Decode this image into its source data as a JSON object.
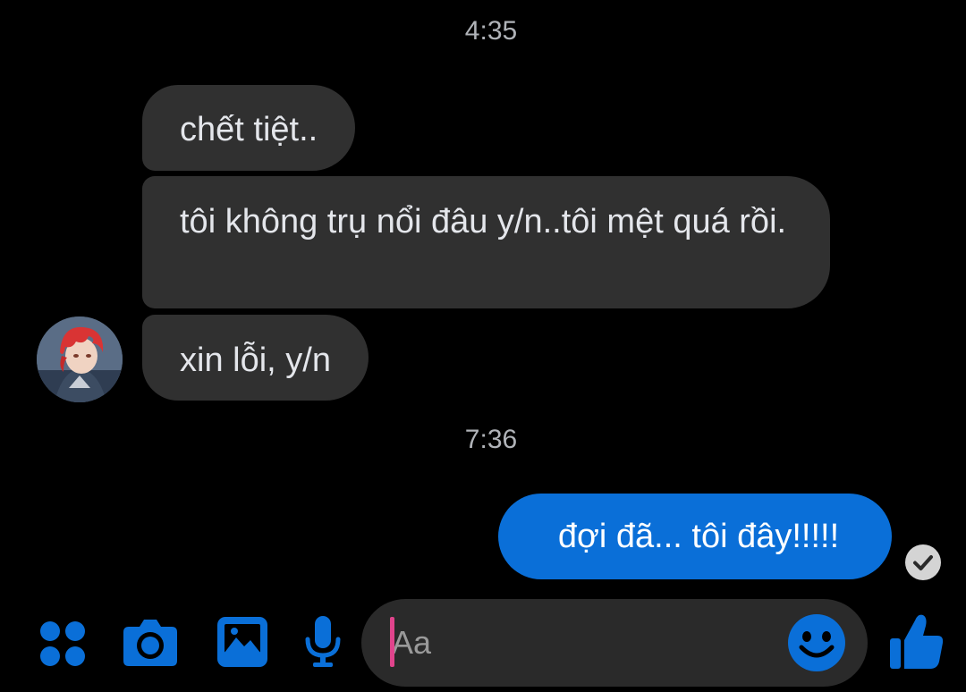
{
  "conversation": {
    "groups": [
      {
        "timestamp": "4:35",
        "messages": [
          {
            "sender": "other",
            "text": "chết tiệt.."
          },
          {
            "sender": "other",
            "text": "tôi không trụ nổi đâu y/n..tôi mệt quá rồi."
          },
          {
            "sender": "other",
            "text": "xin lỗi, y/n"
          }
        ]
      },
      {
        "timestamp": "7:36",
        "messages": [
          {
            "sender": "me",
            "text": "đợi đã... tôi đây!!!!!"
          }
        ]
      }
    ],
    "seen_status": "check-circle-icon"
  },
  "composer": {
    "placeholder": "Aa",
    "value": "",
    "actions": [
      "grid-menu-icon",
      "camera-icon",
      "gallery-icon",
      "microphone-icon",
      "emoji-icon",
      "thumbs-up-icon"
    ]
  },
  "colors": {
    "background": "#000000",
    "incoming_bubble": "#303030",
    "outgoing_bubble": "#0a6fd8",
    "accent": "#0a6fd8",
    "timestamp": "#b0b3b8",
    "cursor": "#e0448c"
  }
}
